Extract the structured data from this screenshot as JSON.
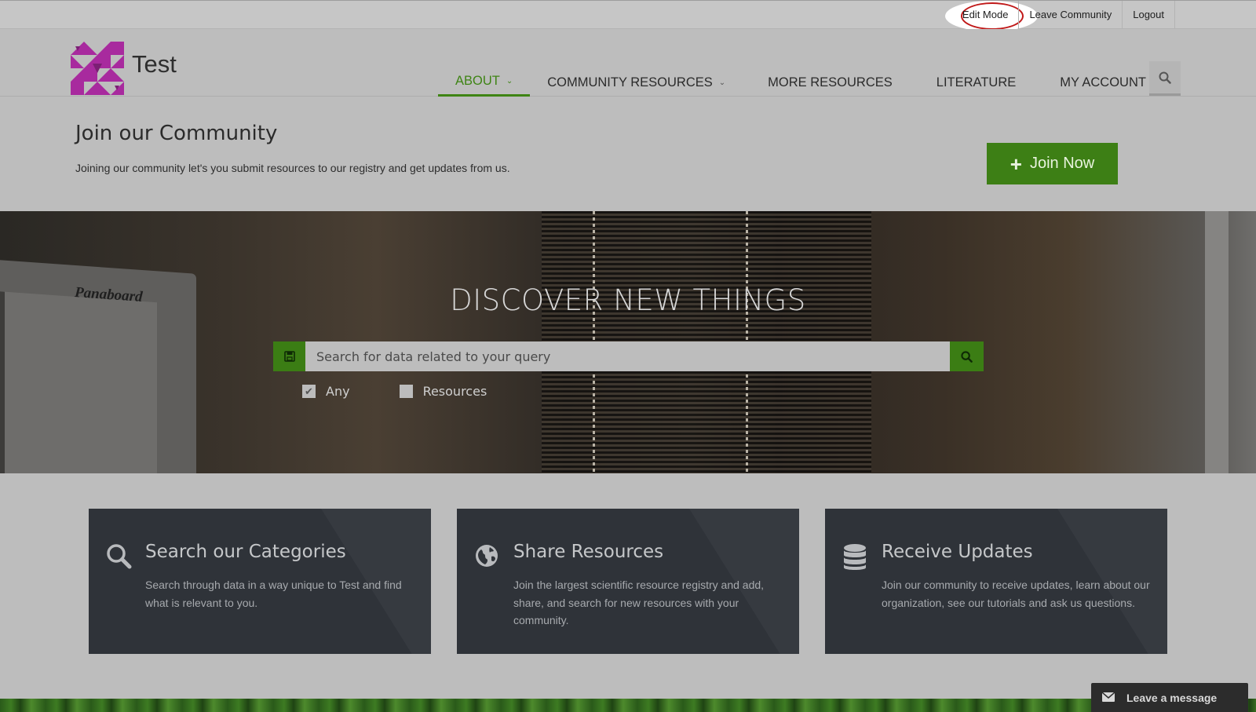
{
  "toplinks": {
    "edit_mode": "Edit Mode",
    "leave_community": "Leave Community",
    "logout": "Logout"
  },
  "header": {
    "site_title": "Test",
    "nav": [
      {
        "label": "ABOUT",
        "has_dropdown": true,
        "active": true
      },
      {
        "label": "COMMUNITY RESOURCES",
        "has_dropdown": true
      },
      {
        "label": "MORE RESOURCES",
        "has_dropdown": false
      },
      {
        "label": "LITERATURE",
        "has_dropdown": false
      },
      {
        "label": "MY ACCOUNT",
        "has_dropdown": true
      }
    ],
    "search_icon": "search-icon"
  },
  "join": {
    "title": "Join our Community",
    "subtitle": "Joining our community let's you submit resources to our registry and get updates from us.",
    "button_label": "Join Now"
  },
  "hero": {
    "title": "DISCOVER NEW THINGS",
    "monitor_label": "Panaboard",
    "search_placeholder": "Search for data related to your query",
    "filters": [
      {
        "label": "Any",
        "checked": true
      },
      {
        "label": "Resources",
        "checked": false
      }
    ]
  },
  "features": [
    {
      "icon": "search-icon",
      "title": "Search our Categories",
      "text": "Search through data in a way unique to Test and find what is relevant to you."
    },
    {
      "icon": "globe-icon",
      "title": "Share Resources",
      "text": "Join the largest scientific resource registry and add, share, and search for new resources with your community."
    },
    {
      "icon": "database-icon",
      "title": "Receive Updates",
      "text": "Join our community to receive updates, learn about our organization, see our tutorials and ask us questions."
    }
  ],
  "message_tab": {
    "label": "Leave a message"
  },
  "colors": {
    "accent_green": "#3d7f15",
    "highlight_ring": "#c01818",
    "card_bg": "#2f3339"
  }
}
